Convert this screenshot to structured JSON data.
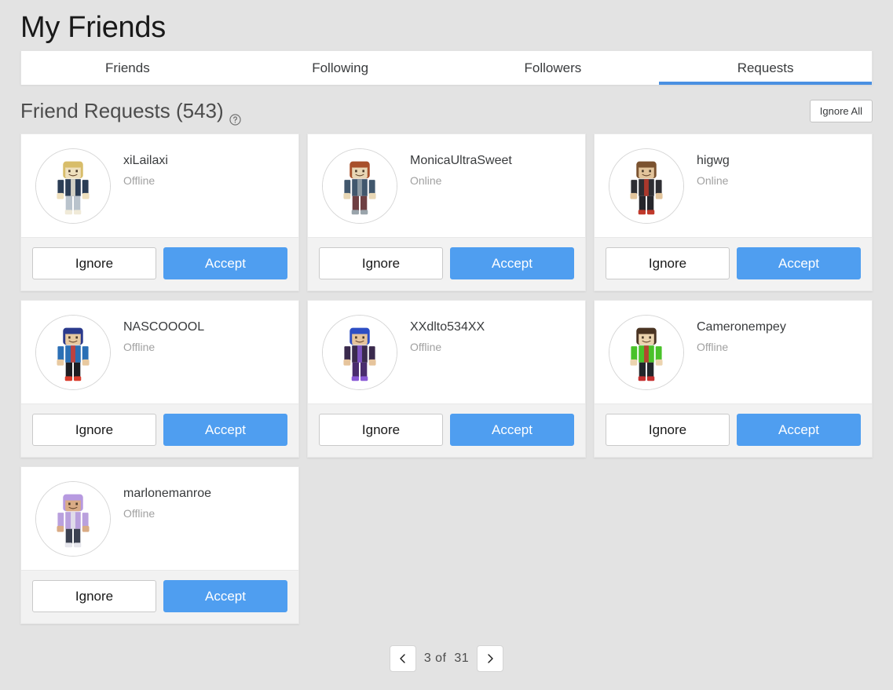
{
  "header": {
    "title": "My Friends"
  },
  "tabs": [
    {
      "label": "Friends",
      "active": false
    },
    {
      "label": "Following",
      "active": false
    },
    {
      "label": "Followers",
      "active": false
    },
    {
      "label": "Requests",
      "active": true
    }
  ],
  "section": {
    "title": "Friend Requests (543)",
    "help_icon": "question-circle-icon",
    "ignore_all_label": "Ignore All"
  },
  "cards": [
    {
      "username": "xiLailaxi",
      "presence": "Offline",
      "ignore_label": "Ignore",
      "accept_label": "Accept",
      "avatar": {
        "hair": "#d8bd6a",
        "shirt": "#2b3d55",
        "pants": "#b9c3cc",
        "skin": "#efe0bd",
        "accent": "#f0ead8"
      }
    },
    {
      "username": "MonicaUltraSweet",
      "presence": "Online",
      "ignore_label": "Ignore",
      "accept_label": "Accept",
      "avatar": {
        "hair": "#a8502a",
        "shirt": "#41576d",
        "pants": "#6e3f42",
        "skin": "#e8d7b5",
        "accent": "#9aa4ab"
      }
    },
    {
      "username": "higwg",
      "presence": "Online",
      "ignore_label": "Ignore",
      "accept_label": "Accept",
      "avatar": {
        "hair": "#7b5330",
        "shirt": "#2e2e33",
        "pants": "#26262b",
        "skin": "#e2c49b",
        "accent": "#c0392b"
      }
    },
    {
      "username": "NASCOOOOL",
      "presence": "Offline",
      "ignore_label": "Ignore",
      "accept_label": "Accept",
      "avatar": {
        "hair": "#2b3a8c",
        "shirt": "#2b6fb5",
        "pants": "#1d1d22",
        "skin": "#e8c9a0",
        "accent": "#d93b2b"
      }
    },
    {
      "username": "XXdlto534XX",
      "presence": "Offline",
      "ignore_label": "Ignore",
      "accept_label": "Accept",
      "avatar": {
        "hair": "#2d4ec4",
        "shirt": "#3a2a4d",
        "pants": "#4a2d6e",
        "skin": "#e6c49c",
        "accent": "#8a5ad6"
      }
    },
    {
      "username": "Cameronempey",
      "presence": "Offline",
      "ignore_label": "Ignore",
      "accept_label": "Accept",
      "avatar": {
        "hair": "#4a3422",
        "shirt": "#49c22a",
        "pants": "#23262b",
        "skin": "#ecd4af",
        "accent": "#c53030"
      }
    },
    {
      "username": "marlonemanroe",
      "presence": "Offline",
      "ignore_label": "Ignore",
      "accept_label": "Accept",
      "avatar": {
        "hair": "#b79ae0",
        "shirt": "#b9a0dd",
        "pants": "#3b4150",
        "skin": "#d9ab85",
        "accent": "#e6e6ec"
      }
    }
  ],
  "pagination": {
    "prev_icon": "chevron-left-icon",
    "next_icon": "chevron-right-icon",
    "label": "3 of  31",
    "current_page": 3,
    "total_pages": 31
  },
  "colors": {
    "accent": "#4a90e2",
    "accept_button": "#4f9ef0",
    "page_background": "#e3e3e3"
  }
}
